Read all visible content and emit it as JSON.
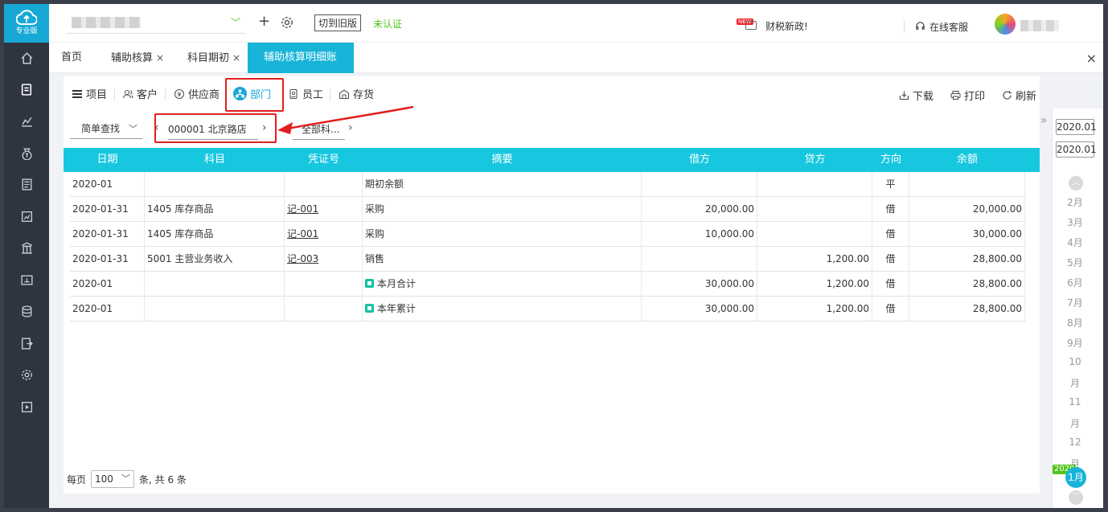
{
  "logo": {
    "label": "专业版"
  },
  "header": {
    "switch_old": "切到旧版",
    "unverified": "未认证",
    "news_tag": "NEW",
    "news": "财税新政!",
    "support": "在线客服"
  },
  "tabs": [
    {
      "label": "首页",
      "closable": false
    },
    {
      "label": "辅助核算",
      "closable": true
    },
    {
      "label": "科目期初",
      "closable": true
    },
    {
      "label": "辅助核算明细账",
      "closable": true,
      "active": true
    }
  ],
  "tab_close": "×",
  "categories": [
    "项目",
    "客户",
    "供应商",
    "部门",
    "员工",
    "存货"
  ],
  "active_category": "部门",
  "actions": {
    "download": "下载",
    "print": "打印",
    "refresh": "刷新"
  },
  "filter": {
    "simple_find": "简单查找",
    "department": "000001  北京路店",
    "all_subjects": "全部科..."
  },
  "table": {
    "columns": [
      "日期",
      "科目",
      "凭证号",
      "摘要",
      "借方",
      "贷方",
      "方向",
      "余额"
    ],
    "rows": [
      {
        "date": "2020-01",
        "subject": "",
        "voucher": "",
        "summary": "期初余额",
        "debit": "",
        "credit": "",
        "dir": "平",
        "balance": "",
        "icon": ""
      },
      {
        "date": "2020-01-31",
        "subject": "1405 库存商品",
        "voucher": "记-001",
        "summary": "采购",
        "debit": "20,000.00",
        "credit": "",
        "dir": "借",
        "balance": "20,000.00",
        "icon": ""
      },
      {
        "date": "2020-01-31",
        "subject": "1405 库存商品",
        "voucher": "记-001",
        "summary": "采购",
        "debit": "10,000.00",
        "credit": "",
        "dir": "借",
        "balance": "30,000.00",
        "icon": ""
      },
      {
        "date": "2020-01-31",
        "subject": "5001 主营业务收入",
        "voucher": "记-003",
        "summary": "销售",
        "debit": "",
        "credit": "1,200.00",
        "dir": "借",
        "balance": "28,800.00",
        "icon": ""
      },
      {
        "date": "2020-01",
        "subject": "",
        "voucher": "",
        "summary": "本月合计",
        "debit": "30,000.00",
        "credit": "1,200.00",
        "dir": "借",
        "balance": "28,800.00",
        "icon": "calendar-month-icon"
      },
      {
        "date": "2020-01",
        "subject": "",
        "voucher": "",
        "summary": "本年累计",
        "debit": "30,000.00",
        "credit": "1,200.00",
        "dir": "借",
        "balance": "28,800.00",
        "icon": "calendar-year-icon"
      }
    ]
  },
  "pager": {
    "prefix": "每页",
    "size": "100",
    "suffix": "条, 共 6 条"
  },
  "period": {
    "start": "2020.01",
    "end": "2020.01",
    "months": [
      "2月",
      "3月",
      "4月",
      "5月",
      "6月",
      "7月",
      "8月",
      "9月",
      "10",
      "月",
      "11",
      "月",
      "12",
      "月"
    ],
    "year_badge": "2020",
    "current": "1月"
  },
  "colors": {
    "accent": "#18b4d8",
    "header": "#17c7e0",
    "highlight": "#e02020",
    "green": "#52c41a"
  }
}
